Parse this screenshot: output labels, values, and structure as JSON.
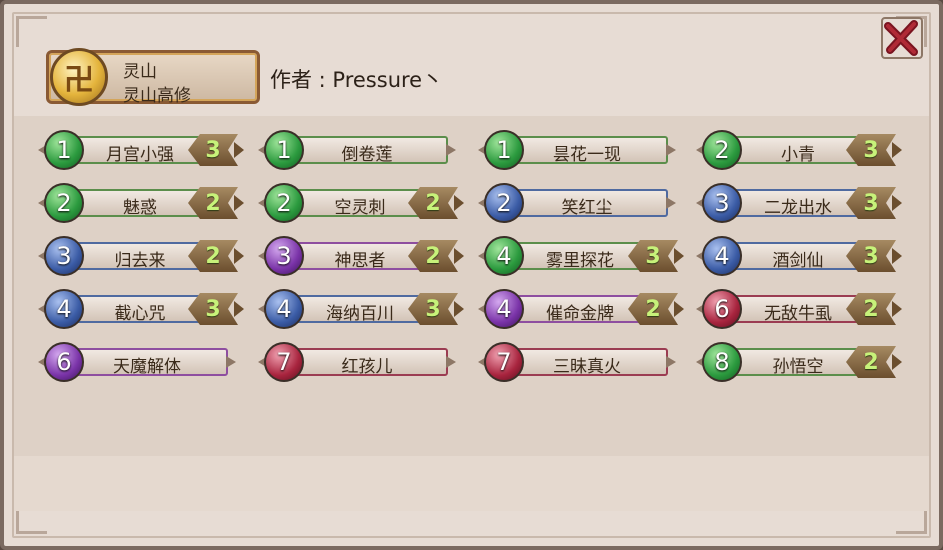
{
  "deck": {
    "class_name": "灵山",
    "deck_name": "灵山高修",
    "icon": "crest-icon",
    "author_label": "作者 : Pressure丶"
  },
  "close_icon": "close-x-icon",
  "colors": {
    "green": "#2b9a3e",
    "blue": "#3b5ca6",
    "purple": "#7a33a8",
    "red": "#a8243e",
    "count_text": "#c7f27a"
  },
  "cards": [
    {
      "cost": "1",
      "name": "月宫小强",
      "count": "3",
      "rarity": "green"
    },
    {
      "cost": "1",
      "name": "倒卷莲",
      "count": "",
      "rarity": "green"
    },
    {
      "cost": "1",
      "name": "昙花一现",
      "count": "",
      "rarity": "green"
    },
    {
      "cost": "2",
      "name": "小青",
      "count": "3",
      "rarity": "green"
    },
    {
      "cost": "2",
      "name": "魅惑",
      "count": "2",
      "rarity": "green"
    },
    {
      "cost": "2",
      "name": "空灵刺",
      "count": "2",
      "rarity": "green"
    },
    {
      "cost": "2",
      "name": "笑红尘",
      "count": "",
      "rarity": "blue"
    },
    {
      "cost": "3",
      "name": "二龙出水",
      "count": "3",
      "rarity": "blue"
    },
    {
      "cost": "3",
      "name": "归去来",
      "count": "2",
      "rarity": "blue"
    },
    {
      "cost": "3",
      "name": "神思者",
      "count": "2",
      "rarity": "purple"
    },
    {
      "cost": "4",
      "name": "雾里探花",
      "count": "3",
      "rarity": "green"
    },
    {
      "cost": "4",
      "name": "酒剑仙",
      "count": "3",
      "rarity": "blue"
    },
    {
      "cost": "4",
      "name": "截心咒",
      "count": "3",
      "rarity": "blue"
    },
    {
      "cost": "4",
      "name": "海纳百川",
      "count": "3",
      "rarity": "blue"
    },
    {
      "cost": "4",
      "name": "催命金牌",
      "count": "2",
      "rarity": "purple"
    },
    {
      "cost": "6",
      "name": "无敌牛虱",
      "count": "2",
      "rarity": "red"
    },
    {
      "cost": "6",
      "name": "天魔解体",
      "count": "",
      "rarity": "purple"
    },
    {
      "cost": "7",
      "name": "红孩儿",
      "count": "",
      "rarity": "red"
    },
    {
      "cost": "7",
      "name": "三昧真火",
      "count": "",
      "rarity": "red"
    },
    {
      "cost": "8",
      "name": "孙悟空",
      "count": "2",
      "rarity": "green"
    }
  ]
}
